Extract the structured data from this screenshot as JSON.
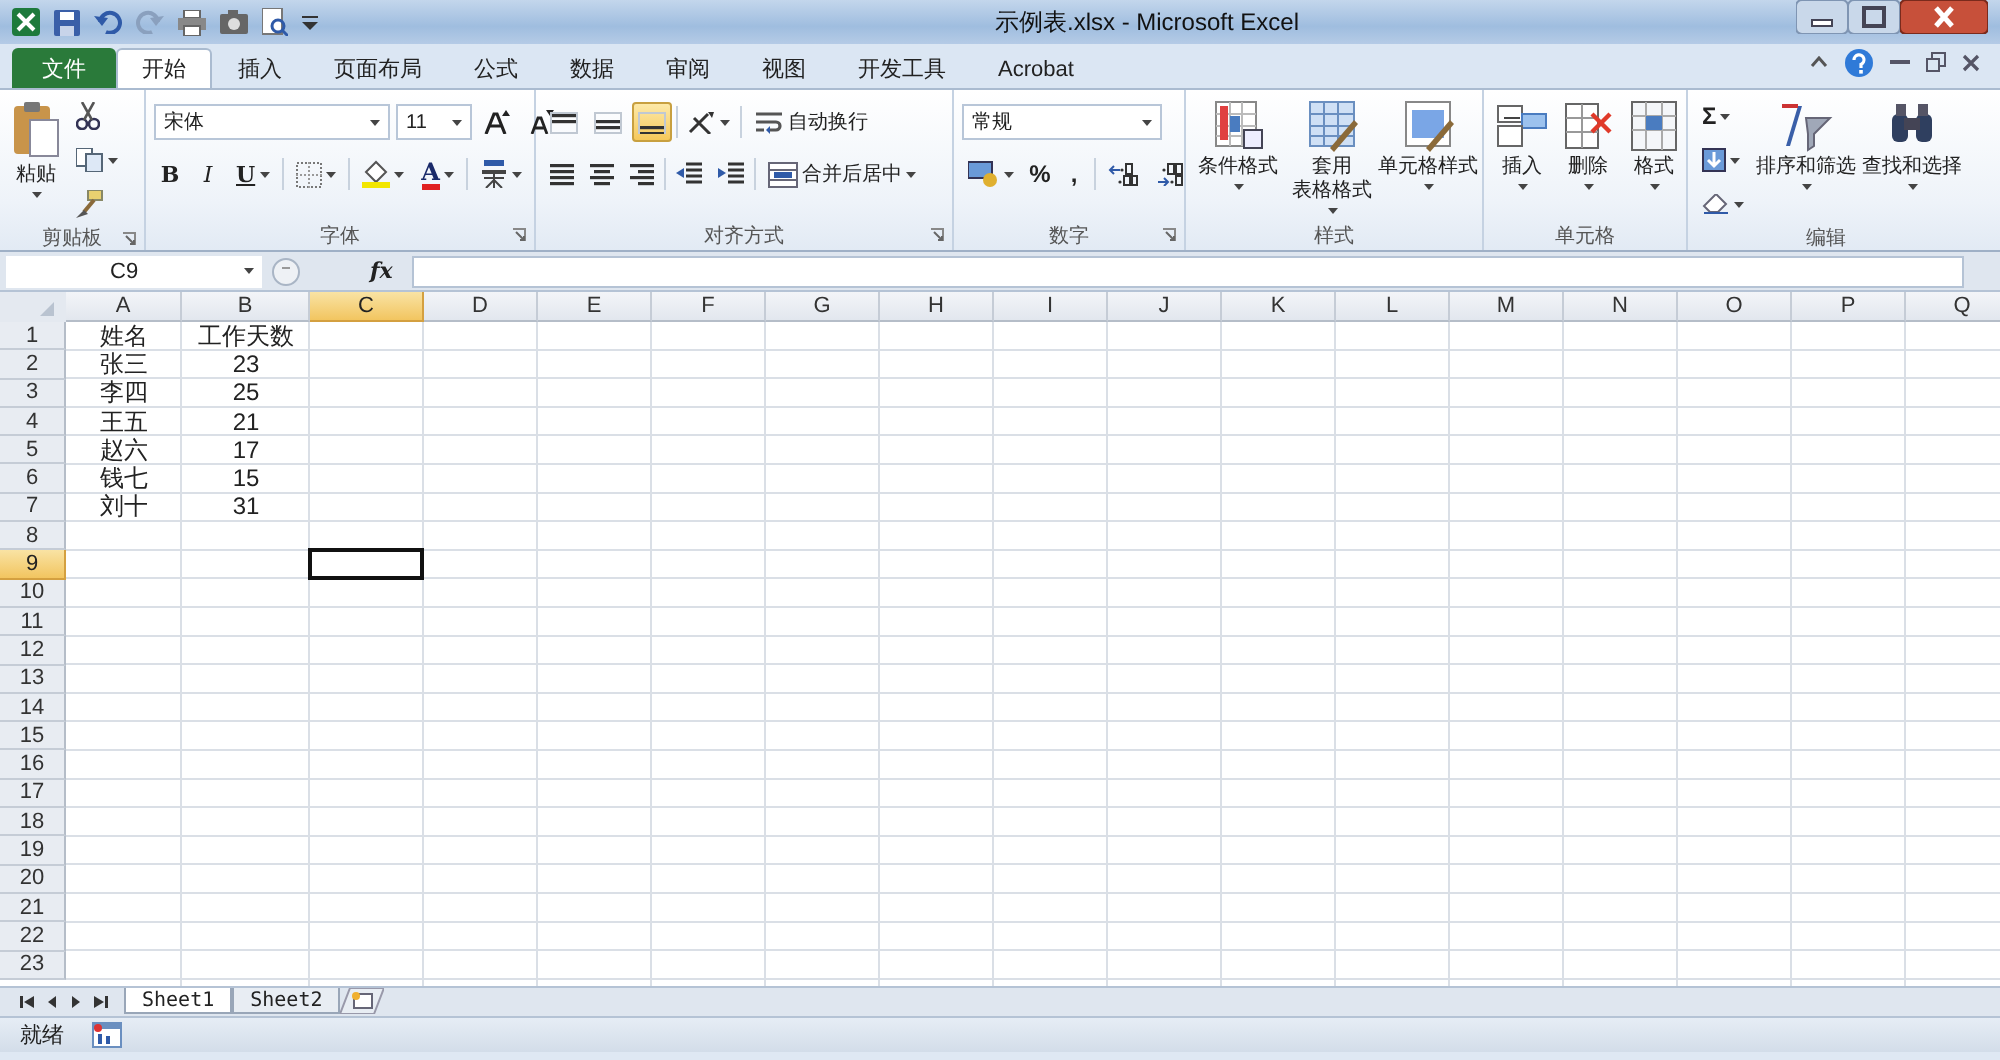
{
  "window": {
    "title": "示例表.xlsx - Microsoft Excel"
  },
  "tabs": [
    {
      "label": "文件",
      "kind": "file",
      "selected": false
    },
    {
      "label": "开始",
      "kind": "tab",
      "selected": true
    },
    {
      "label": "插入",
      "kind": "tab",
      "selected": false
    },
    {
      "label": "页面布局",
      "kind": "tab",
      "selected": false
    },
    {
      "label": "公式",
      "kind": "tab",
      "selected": false
    },
    {
      "label": "数据",
      "kind": "tab",
      "selected": false
    },
    {
      "label": "审阅",
      "kind": "tab",
      "selected": false
    },
    {
      "label": "视图",
      "kind": "tab",
      "selected": false
    },
    {
      "label": "开发工具",
      "kind": "tab",
      "selected": false
    },
    {
      "label": "Acrobat",
      "kind": "tab",
      "selected": false
    }
  ],
  "ribbon": [
    {
      "kind": "clipboard",
      "label": "剪贴板",
      "launcher": true,
      "paste": "粘贴"
    },
    {
      "kind": "font",
      "label": "字体",
      "launcher": true,
      "font": "宋体",
      "size": "11",
      "bold": "B",
      "italic": "I",
      "underline": "U",
      "font_color": "A"
    },
    {
      "kind": "alignment",
      "label": "对齐方式",
      "launcher": true,
      "wrap": "自动换行",
      "merge": "合并后居中",
      "vertical": [
        {
          "selected": false
        },
        {
          "selected": false
        },
        {
          "selected": true
        }
      ]
    },
    {
      "kind": "number",
      "label": "数字",
      "launcher": true,
      "format": "常规",
      "percent": "%",
      "comma": ","
    },
    {
      "kind": "styles",
      "label": "样式",
      "buttons": [
        {
          "lines": [
            "条件格式"
          ]
        },
        {
          "lines": [
            "套用",
            "表格格式"
          ]
        },
        {
          "lines": [
            "单元格样式"
          ]
        }
      ]
    },
    {
      "kind": "cells",
      "label": "单元格",
      "buttons": [
        {
          "lines": [
            "插入"
          ]
        },
        {
          "lines": [
            "删除"
          ]
        },
        {
          "lines": [
            "格式"
          ]
        }
      ]
    },
    {
      "kind": "editing",
      "label": "编辑",
      "sum": "Σ",
      "buttons": [
        {
          "lines": [
            "排序和筛选"
          ]
        },
        {
          "lines": [
            "查找和选择"
          ]
        }
      ]
    }
  ],
  "formula_bar": {
    "name_box": "C9",
    "fx": "fx"
  },
  "grid": {
    "columns": [
      {
        "label": "A",
        "selected": false
      },
      {
        "label": "B",
        "selected": false
      },
      {
        "label": "C",
        "selected": true
      },
      {
        "label": "D",
        "selected": false
      },
      {
        "label": "E",
        "selected": false
      },
      {
        "label": "F",
        "selected": false
      },
      {
        "label": "G",
        "selected": false
      },
      {
        "label": "H",
        "selected": false
      },
      {
        "label": "I",
        "selected": false
      },
      {
        "label": "J",
        "selected": false
      },
      {
        "label": "K",
        "selected": false
      },
      {
        "label": "L",
        "selected": false
      },
      {
        "label": "M",
        "selected": false
      },
      {
        "label": "N",
        "selected": false
      },
      {
        "label": "O",
        "selected": false
      },
      {
        "label": "P",
        "selected": false
      },
      {
        "label": "Q",
        "selected": false
      }
    ],
    "rows": [
      {
        "number": "1",
        "selected": false,
        "cells": [
          "姓名",
          "工作天数"
        ]
      },
      {
        "number": "2",
        "selected": false,
        "cells": [
          "张三",
          "23"
        ]
      },
      {
        "number": "3",
        "selected": false,
        "cells": [
          "李四",
          "25"
        ]
      },
      {
        "number": "4",
        "selected": false,
        "cells": [
          "王五",
          "21"
        ]
      },
      {
        "number": "5",
        "selected": false,
        "cells": [
          "赵六",
          "17"
        ]
      },
      {
        "number": "6",
        "selected": false,
        "cells": [
          "钱七",
          "15"
        ]
      },
      {
        "number": "7",
        "selected": false,
        "cells": [
          "刘十",
          "31"
        ]
      },
      {
        "number": "8",
        "selected": false
      },
      {
        "number": "9",
        "selected": true
      },
      {
        "number": "10",
        "selected": false
      },
      {
        "number": "11",
        "selected": false
      },
      {
        "number": "12",
        "selected": false
      },
      {
        "number": "13",
        "selected": false
      },
      {
        "number": "14",
        "selected": false
      },
      {
        "number": "15",
        "selected": false
      },
      {
        "number": "16",
        "selected": false
      },
      {
        "number": "17",
        "selected": false
      },
      {
        "number": "18",
        "selected": false
      },
      {
        "number": "19",
        "selected": false
      },
      {
        "number": "20",
        "selected": false
      },
      {
        "number": "21",
        "selected": false
      },
      {
        "number": "22",
        "selected": false
      },
      {
        "number": "23",
        "selected": false
      }
    ]
  },
  "sheet_tabs": [
    {
      "label": "Sheet1",
      "selected": true
    },
    {
      "label": "Sheet2",
      "selected": false
    }
  ],
  "status_bar": {
    "text": "就绪"
  }
}
